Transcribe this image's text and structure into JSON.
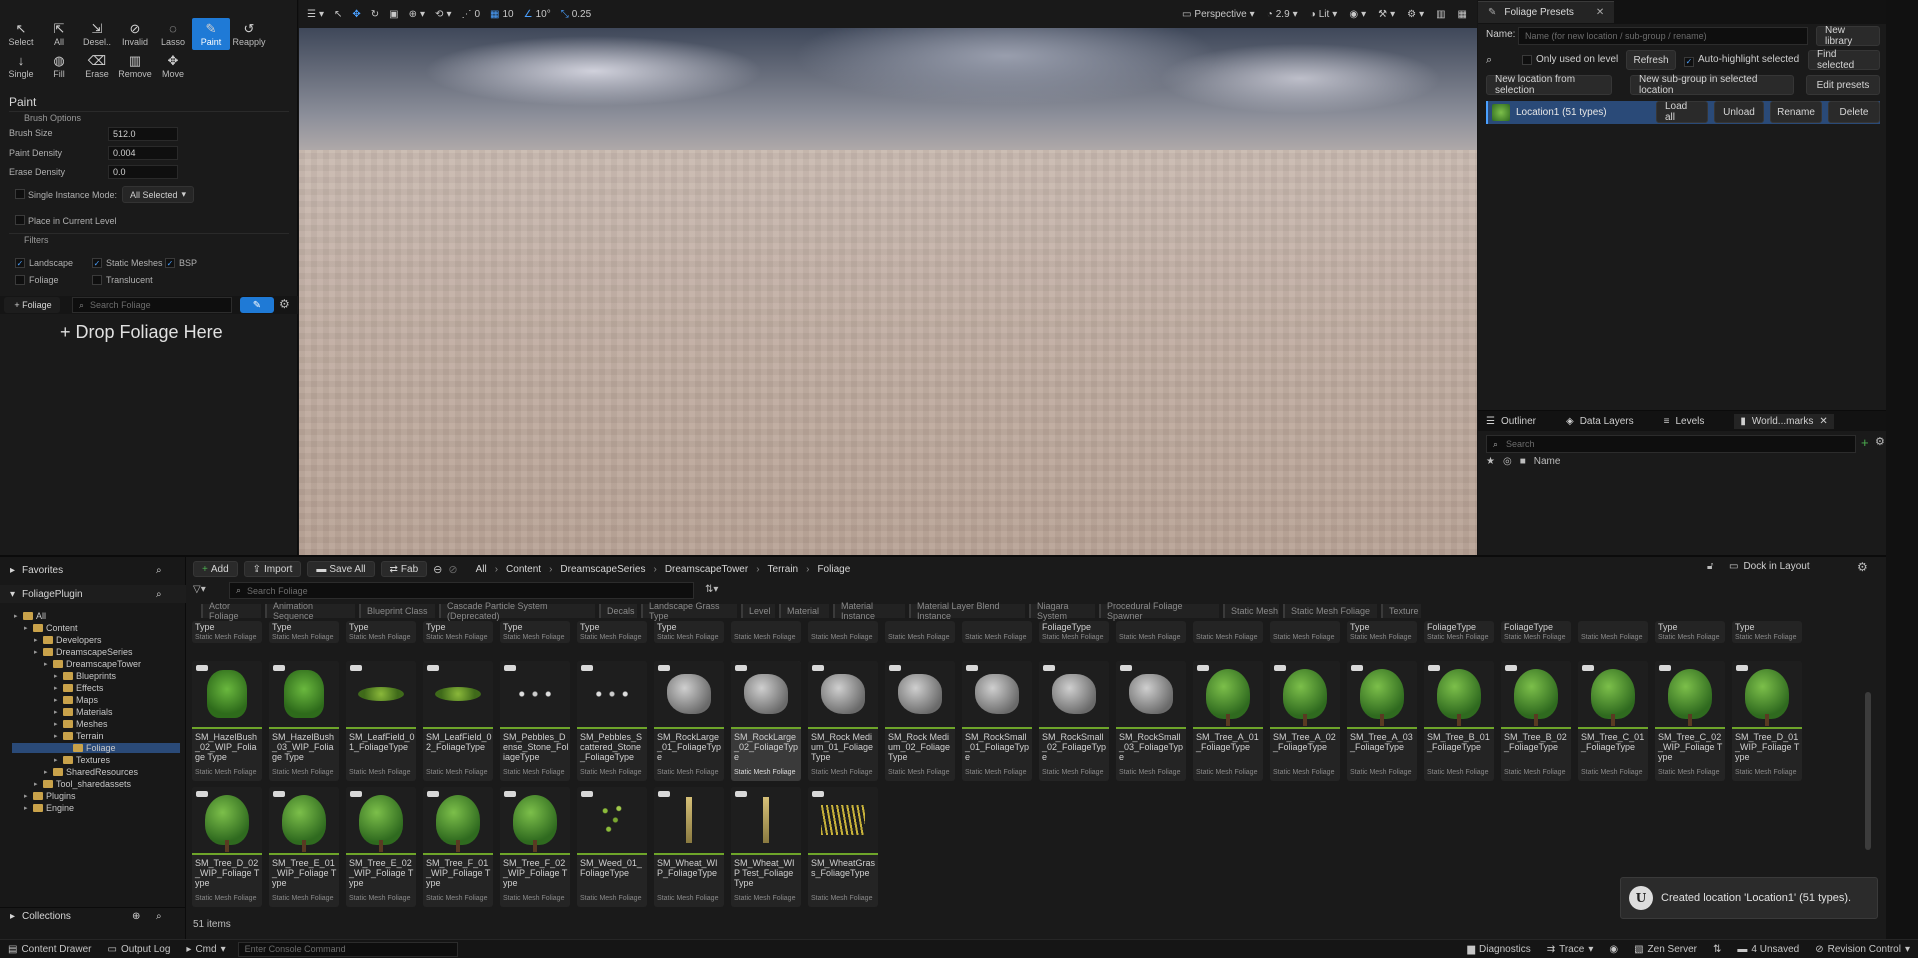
{
  "foliage_tools": {
    "row1": [
      {
        "icon": "cursor-icon",
        "label": "Select"
      },
      {
        "icon": "select-all-icon",
        "label": "All"
      },
      {
        "icon": "deselect-icon",
        "label": "Desel.."
      },
      {
        "icon": "invalid-icon",
        "label": "Invalid"
      },
      {
        "icon": "lasso-icon",
        "label": "Lasso"
      },
      {
        "icon": "paint-brush-icon",
        "label": "Paint",
        "active": true
      },
      {
        "icon": "reapply-icon",
        "label": "Reapply"
      }
    ],
    "row2": [
      {
        "icon": "single-icon",
        "label": "Single"
      },
      {
        "icon": "fill-icon",
        "label": "Fill"
      },
      {
        "icon": "erase-icon",
        "label": "Erase"
      },
      {
        "icon": "trash-icon",
        "label": "Remove"
      },
      {
        "icon": "move-icon",
        "label": "Move"
      }
    ]
  },
  "paint_panel": {
    "title": "Paint",
    "brush_options_label": "Brush Options",
    "brush_size_label": "Brush Size",
    "brush_size_value": "512.0",
    "paint_density_label": "Paint Density",
    "paint_density_value": "0.004",
    "erase_density_label": "Erase Density",
    "erase_density_value": "0.0",
    "single_instance_label": "Single Instance Mode:",
    "single_instance_value": "All Selected",
    "place_current_level_label": "Place in Current Level",
    "filters_label": "Filters",
    "filters": [
      {
        "label": "Landscape",
        "checked": true
      },
      {
        "label": "Static Meshes",
        "checked": true
      },
      {
        "label": "BSP",
        "checked": true
      },
      {
        "label": "Foliage",
        "checked": false
      },
      {
        "label": "Translucent",
        "checked": false
      }
    ],
    "add_foliage_label": "+ Foliage",
    "search_placeholder": "Search Foliage",
    "drop_label": "+ Drop Foliage Here"
  },
  "viewport": {
    "toolbar": {
      "snap_angle": "0°",
      "grid_size": "10",
      "rotation_snap": "10°",
      "scale_snap": "0.25",
      "zero_label": "0",
      "perspective_label": "Perspective",
      "fov_value": "2.9",
      "lit_label": "Lit"
    }
  },
  "foliage_presets": {
    "tab_label": "Foliage Presets",
    "name_label": "Name:",
    "name_placeholder": "Name (for new location / sub-group / rename)",
    "new_library_label": "New library",
    "only_used_label": "Only used on level",
    "refresh_label": "Refresh",
    "auto_highlight_label": "Auto-highlight selected",
    "find_selected_label": "Find selected",
    "new_location_label": "New location from selection",
    "new_subgroup_label": "New sub-group in selected location",
    "edit_presets_label": "Edit presets",
    "location_name": "Location1",
    "location_count": "(51 types)",
    "load_all_label": "Load all",
    "unload_label": "Unload",
    "rename_label": "Rename",
    "delete_label": "Delete"
  },
  "outliner": {
    "tabs": [
      "Outliner",
      "Data Layers",
      "Levels",
      "World...marks"
    ],
    "search_placeholder": "Search",
    "name_col": "Name"
  },
  "content_browser": {
    "favorites_label": "Favorites",
    "plugin_label": "FoliagePlugin",
    "tree": [
      {
        "label": "All",
        "depth": 0
      },
      {
        "label": "Content",
        "depth": 1
      },
      {
        "label": "Developers",
        "depth": 2
      },
      {
        "label": "DreamscapeSeries",
        "depth": 2
      },
      {
        "label": "DreamscapeTower",
        "depth": 3
      },
      {
        "label": "Blueprints",
        "depth": 4
      },
      {
        "label": "Effects",
        "depth": 4
      },
      {
        "label": "Maps",
        "depth": 4
      },
      {
        "label": "Materials",
        "depth": 4
      },
      {
        "label": "Meshes",
        "depth": 4
      },
      {
        "label": "Terrain",
        "depth": 4
      },
      {
        "label": "Foliage",
        "depth": 5,
        "selected": true
      },
      {
        "label": "Textures",
        "depth": 4
      },
      {
        "label": "SharedResources",
        "depth": 3
      },
      {
        "label": "Tool_sharedassets",
        "depth": 2
      },
      {
        "label": "Plugins",
        "depth": 1
      },
      {
        "label": "Engine",
        "depth": 1
      }
    ],
    "collections_label": "Collections",
    "toolbar": {
      "add_label": "Add",
      "import_label": "Import",
      "save_all_label": "Save All",
      "fab_label": "Fab",
      "dock_label": "Dock in Layout"
    },
    "breadcrumb": [
      "All",
      "Content",
      "DreamscapeSeries",
      "DreamscapeTower",
      "Terrain",
      "Foliage"
    ],
    "search_placeholder": "Search Foliage",
    "filters": [
      "Actor Foliage",
      "Animation Sequence",
      "Blueprint Class",
      "Cascade Particle System (Deprecated)",
      "Decals",
      "Landscape Grass Type",
      "Level",
      "Material",
      "Material Instance",
      "Material Layer Blend Instance",
      "Niagara System",
      "Procedural Foliage Spawner",
      "Static Mesh",
      "Static Mesh Foliage",
      "Texture"
    ],
    "top_row_labels": [
      "Type",
      "Type",
      "Type",
      "Type",
      "Type",
      "Type",
      "Type",
      "",
      "",
      "",
      "",
      "FoliageType",
      "",
      "",
      "",
      "Type",
      "FoliageType",
      "FoliageType",
      "",
      "Type",
      "Type"
    ],
    "type_label": "Static Mesh Foliage",
    "assets_row1": [
      {
        "name": "SM_HazelBush_02_WIP_Foliage Type",
        "kind": "bush"
      },
      {
        "name": "SM_HazelBush_03_WIP_Foliage Type",
        "kind": "bush"
      },
      {
        "name": "SM_LeafField_01_FoliageType",
        "kind": "leaf"
      },
      {
        "name": "SM_LeafField_02_FoliageType",
        "kind": "leaf"
      },
      {
        "name": "SM_Pebbles_Dense_Stone_FoliageType",
        "kind": "pebble"
      },
      {
        "name": "SM_Pebbles_Scattered_Stone_FoliageType",
        "kind": "pebble"
      },
      {
        "name": "SM_RockLarge_01_FoliageType",
        "kind": "rock"
      },
      {
        "name": "SM_RockLarge_02_FoliageType",
        "kind": "rock",
        "selected": true
      },
      {
        "name": "SM_Rock Medium_01_FoliageType",
        "kind": "rock"
      },
      {
        "name": "SM_Rock Medium_02_FoliageType",
        "kind": "rock"
      },
      {
        "name": "SM_RockSmall_01_FoliageType",
        "kind": "rock"
      },
      {
        "name": "SM_RockSmall_02_FoliageType",
        "kind": "rock"
      },
      {
        "name": "SM_RockSmall_03_FoliageType",
        "kind": "rock"
      },
      {
        "name": "SM_Tree_A_01_FoliageType",
        "kind": "tree"
      },
      {
        "name": "SM_Tree_A_02_FoliageType",
        "kind": "tree"
      },
      {
        "name": "SM_Tree_A_03_FoliageType",
        "kind": "tree"
      },
      {
        "name": "SM_Tree_B_01_FoliageType",
        "kind": "tree"
      },
      {
        "name": "SM_Tree_B_02_FoliageType",
        "kind": "tree"
      },
      {
        "name": "SM_Tree_C_01_FoliageType",
        "kind": "tree"
      },
      {
        "name": "SM_Tree_C_02_WIP_Foliage Type",
        "kind": "tree"
      },
      {
        "name": "SM_Tree_D_01_WIP_Foliage Type",
        "kind": "tree"
      }
    ],
    "assets_row2": [
      {
        "name": "SM_Tree_D_02_WIP_Foliage Type",
        "kind": "tree"
      },
      {
        "name": "SM_Tree_E_01_WIP_Foliage Type",
        "kind": "tree"
      },
      {
        "name": "SM_Tree_E_02_WIP_Foliage Type",
        "kind": "tree"
      },
      {
        "name": "SM_Tree_F_01_WIP_Foliage Type",
        "kind": "tree"
      },
      {
        "name": "SM_Tree_F_02_WIP_Foliage Type",
        "kind": "tree"
      },
      {
        "name": "SM_Weed_01_FoliageType",
        "kind": "weed"
      },
      {
        "name": "SM_Wheat_WIP_FoliageType",
        "kind": "wheat"
      },
      {
        "name": "SM_Wheat_WIP Test_Foliage Type",
        "kind": "wheat"
      },
      {
        "name": "SM_WheatGrass_FoliageType",
        "kind": "grass"
      }
    ],
    "item_count": "51 items"
  },
  "toast": {
    "message": "Created location 'Location1' (51 types)."
  },
  "statusbar": {
    "content_drawer": "Content Drawer",
    "output_log": "Output Log",
    "cmd": "Cmd",
    "console_placeholder": "Enter Console Command",
    "diagnostics": "Diagnostics",
    "trace": "Trace",
    "zen_server": "Zen Server",
    "unsaved": "4 Unsaved",
    "revision_control": "Revision Control"
  },
  "colors": {
    "accent": "#1f7ad6",
    "foliage_bar": "#6ea52a",
    "folder": "#c9a24a"
  }
}
